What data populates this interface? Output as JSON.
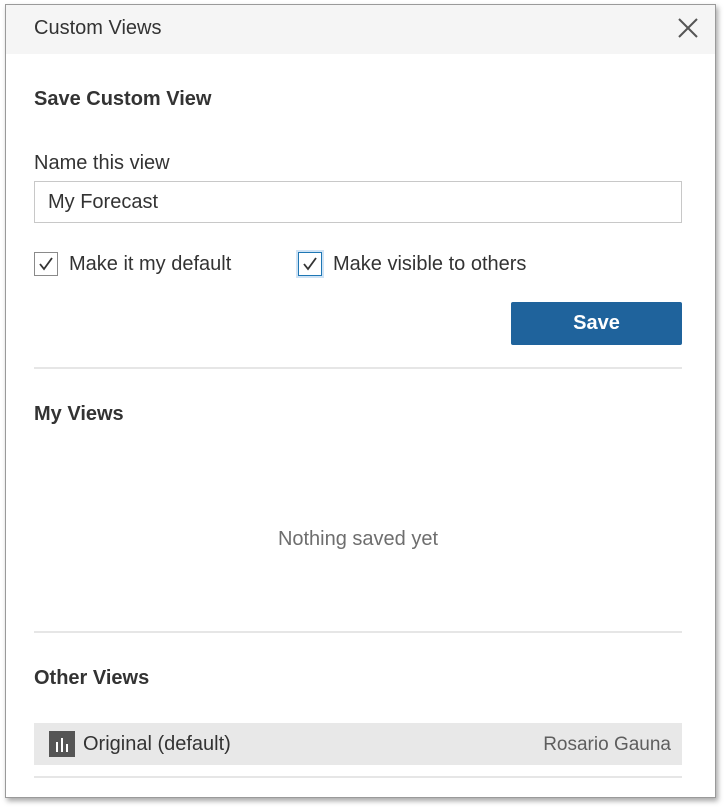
{
  "dialog": {
    "title": "Custom Views",
    "close_icon": "close-icon"
  },
  "save_section": {
    "heading": "Save Custom View",
    "name_label": "Name this view",
    "name_value": "My Forecast",
    "default_checkbox": {
      "label": "Make it my default",
      "checked": true
    },
    "visible_checkbox": {
      "label": "Make visible to others",
      "checked": true
    },
    "save_label": "Save"
  },
  "my_views": {
    "heading": "My Views",
    "empty_message": "Nothing saved yet"
  },
  "other_views": {
    "heading": "Other Views",
    "items": [
      {
        "icon": "bar-chart-icon",
        "name": "Original (default)",
        "owner": "Rosario Gauna"
      }
    ]
  },
  "colors": {
    "primary_button": "#1f639c",
    "title_bar": "#f5f5f5",
    "row_background": "#e8e8e8",
    "focus_ring": "#1f77b4"
  }
}
